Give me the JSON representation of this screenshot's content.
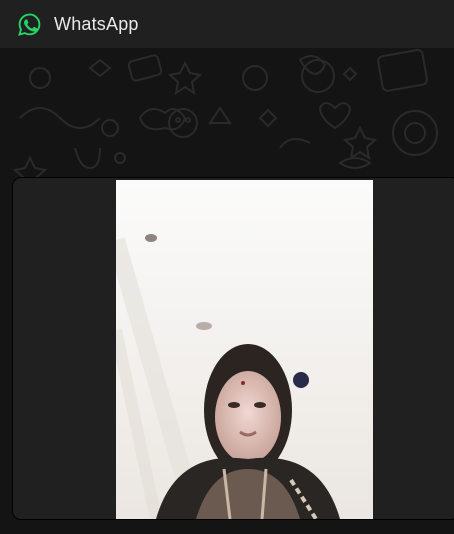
{
  "app": {
    "title": "WhatsApp",
    "icon": "whatsapp-logo-icon",
    "accent": "#25D366"
  },
  "chat": {
    "wallpaper": "doodle-pattern",
    "message": {
      "type": "video",
      "content": "video-frame-person"
    }
  }
}
